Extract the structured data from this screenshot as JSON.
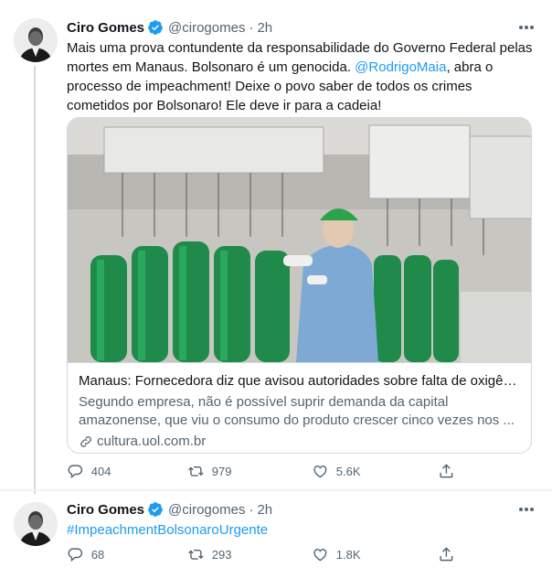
{
  "tweets": [
    {
      "author_name": "Ciro Gomes",
      "handle": "@cirogomes",
      "separator": "·",
      "time": "2h",
      "text_parts": {
        "before_mention": "Mais uma prova contundente da responsabilidade do Governo Federal pelas mortes em Manaus. Bolsonaro é um genocida. ",
        "mention": "@RodrigoMaia",
        "after_mention": ", abra o processo de impeachment! Deixe o povo saber de todos os crimes cometidos por Bolsonaro! Ele deve ir para a cadeia!"
      },
      "card": {
        "title": "Manaus: Fornecedora diz que avisou autoridades sobre falta de oxigêni...",
        "description": "Segundo empresa, não é possível suprir demanda da capital amazonense, que viu o consumo do produto crescer cinco vezes nos ...",
        "domain": "cultura.uol.com.br"
      },
      "actions": {
        "replies": "404",
        "retweets": "979",
        "likes": "5.6K"
      }
    },
    {
      "author_name": "Ciro Gomes",
      "handle": "@cirogomes",
      "separator": "·",
      "time": "2h",
      "hashtag": "#ImpeachmentBolsonaroUrgente",
      "actions": {
        "replies": "68",
        "retweets": "293",
        "likes": "1.8K"
      }
    }
  ],
  "colors": {
    "accent": "#1d9bf0",
    "text_primary": "#0f1419",
    "text_secondary": "#536471",
    "border": "#cfd9de",
    "cylinder_green": "#1f8a4a"
  },
  "icons": [
    "verified-badge-icon",
    "more-options-icon",
    "link-icon",
    "reply-icon",
    "retweet-icon",
    "like-icon",
    "share-icon"
  ]
}
